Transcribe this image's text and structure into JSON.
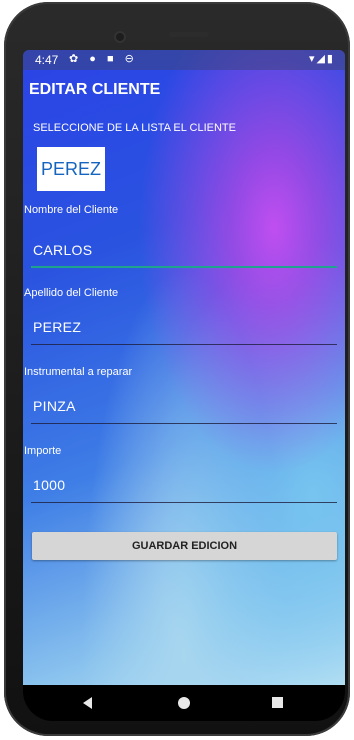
{
  "status_bar": {
    "time": "4:47",
    "left_icons": "✿ ● ■ ⊖",
    "right_icons": "▾◢▮"
  },
  "screen": {
    "title": "EDITAR CLIENTE",
    "instruction": "SELECCIONE DE LA LISTA EL CLIENTE",
    "client_spinner": {
      "selected": "PEREZ"
    }
  },
  "form": {
    "fields": [
      {
        "label": "Nombre del Cliente",
        "value": "CARLOS"
      },
      {
        "label": "Apellido del Cliente",
        "value": "PEREZ"
      },
      {
        "label": "Instrumental a reparar",
        "value": "PINZA"
      },
      {
        "label": "Importe",
        "value": "1000"
      }
    ],
    "save_button": "GUARDAR EDICION"
  },
  "nav": {
    "back_icon": "back-triangle",
    "home_icon": "home-circle",
    "recents_icon": "recents-square"
  },
  "colors": {
    "accent_underline": "#1fa38f",
    "title_text": "#ffffff",
    "spinner_text": "#1565c0",
    "button_bg": "#d6d6d6"
  }
}
